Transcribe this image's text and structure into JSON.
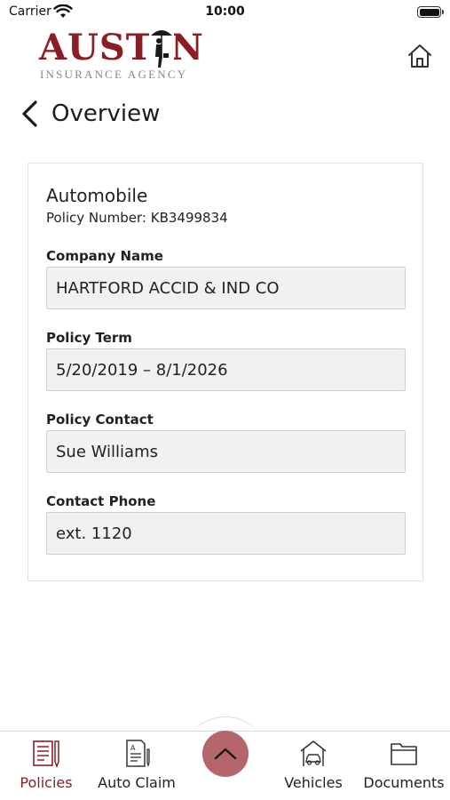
{
  "status_bar": {
    "carrier": "Carrier",
    "time": "10:00"
  },
  "header": {
    "logo_wordmark": "AUSTIN",
    "logo_subtitle": "INSURANCE AGENCY",
    "home_icon": "home-icon"
  },
  "navigation": {
    "back_icon": "chevron-left-icon",
    "title": "Overview"
  },
  "policy": {
    "type": "Automobile",
    "policy_number_text": "Policy Number: KB3499834",
    "fields": [
      {
        "label": "Company Name",
        "value": "HARTFORD ACCID & IND CO"
      },
      {
        "label": "Policy Term",
        "value": "5/20/2019 – 8/1/2026"
      },
      {
        "label": "Policy Contact",
        "value": "Sue Williams"
      },
      {
        "label": "Contact Phone",
        "value": "ext. 1120"
      }
    ]
  },
  "tab_bar": {
    "tabs": [
      {
        "label": "Policies",
        "icon": "policy-document-icon",
        "active": true
      },
      {
        "label": "Auto Claim",
        "icon": "claim-form-icon",
        "active": false
      },
      {
        "label": "Vehicles",
        "icon": "car-garage-icon",
        "active": false
      },
      {
        "label": "Documents",
        "icon": "folder-icon",
        "active": false
      }
    ],
    "center_button_icon": "chevron-up-icon"
  },
  "colors": {
    "brand": "#8b1e24",
    "fab": "#b5666a",
    "field_background": "#f1f1f1"
  }
}
